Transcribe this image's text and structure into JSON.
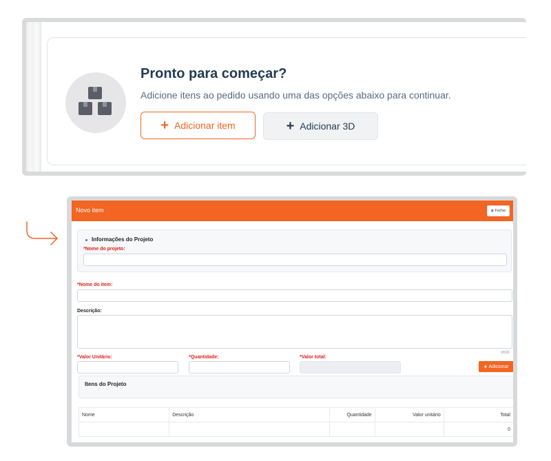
{
  "empty_state": {
    "title": "Pronto para começar?",
    "subtitle": "Adicione itens ao pedido usando uma das opções abaixo para continuar.",
    "add_item_label": "Adicionar item",
    "add_3d_label": "Adicionar 3D",
    "icon": "boxes-icon"
  },
  "modal": {
    "title": "Novo item",
    "close_label": "Fechar",
    "project_section": {
      "title": "Informações do Projeto",
      "project_name_label": "*Nome do projeto:",
      "project_name_value": ""
    },
    "item_name_label": "*Nome do item:",
    "item_name_value": "",
    "description_label": "Descrição:",
    "description_value": "",
    "description_counter": "0/500",
    "unit_value_label": "*Valor Unitário:",
    "quantity_label": "*Quantidade:",
    "total_value_label": "*Valor total:",
    "add_button_label": "Adicionar",
    "items_section_title": "Itens do Projeto",
    "table": {
      "headers": [
        "Nome",
        "Descrição",
        "Quantidade",
        "Valor unitário",
        "Total"
      ],
      "rows": [
        [
          "",
          "",
          "",
          "",
          "0"
        ]
      ]
    }
  },
  "colors": {
    "accent": "#f26522",
    "required": "#e0201e",
    "title": "#243b53"
  }
}
